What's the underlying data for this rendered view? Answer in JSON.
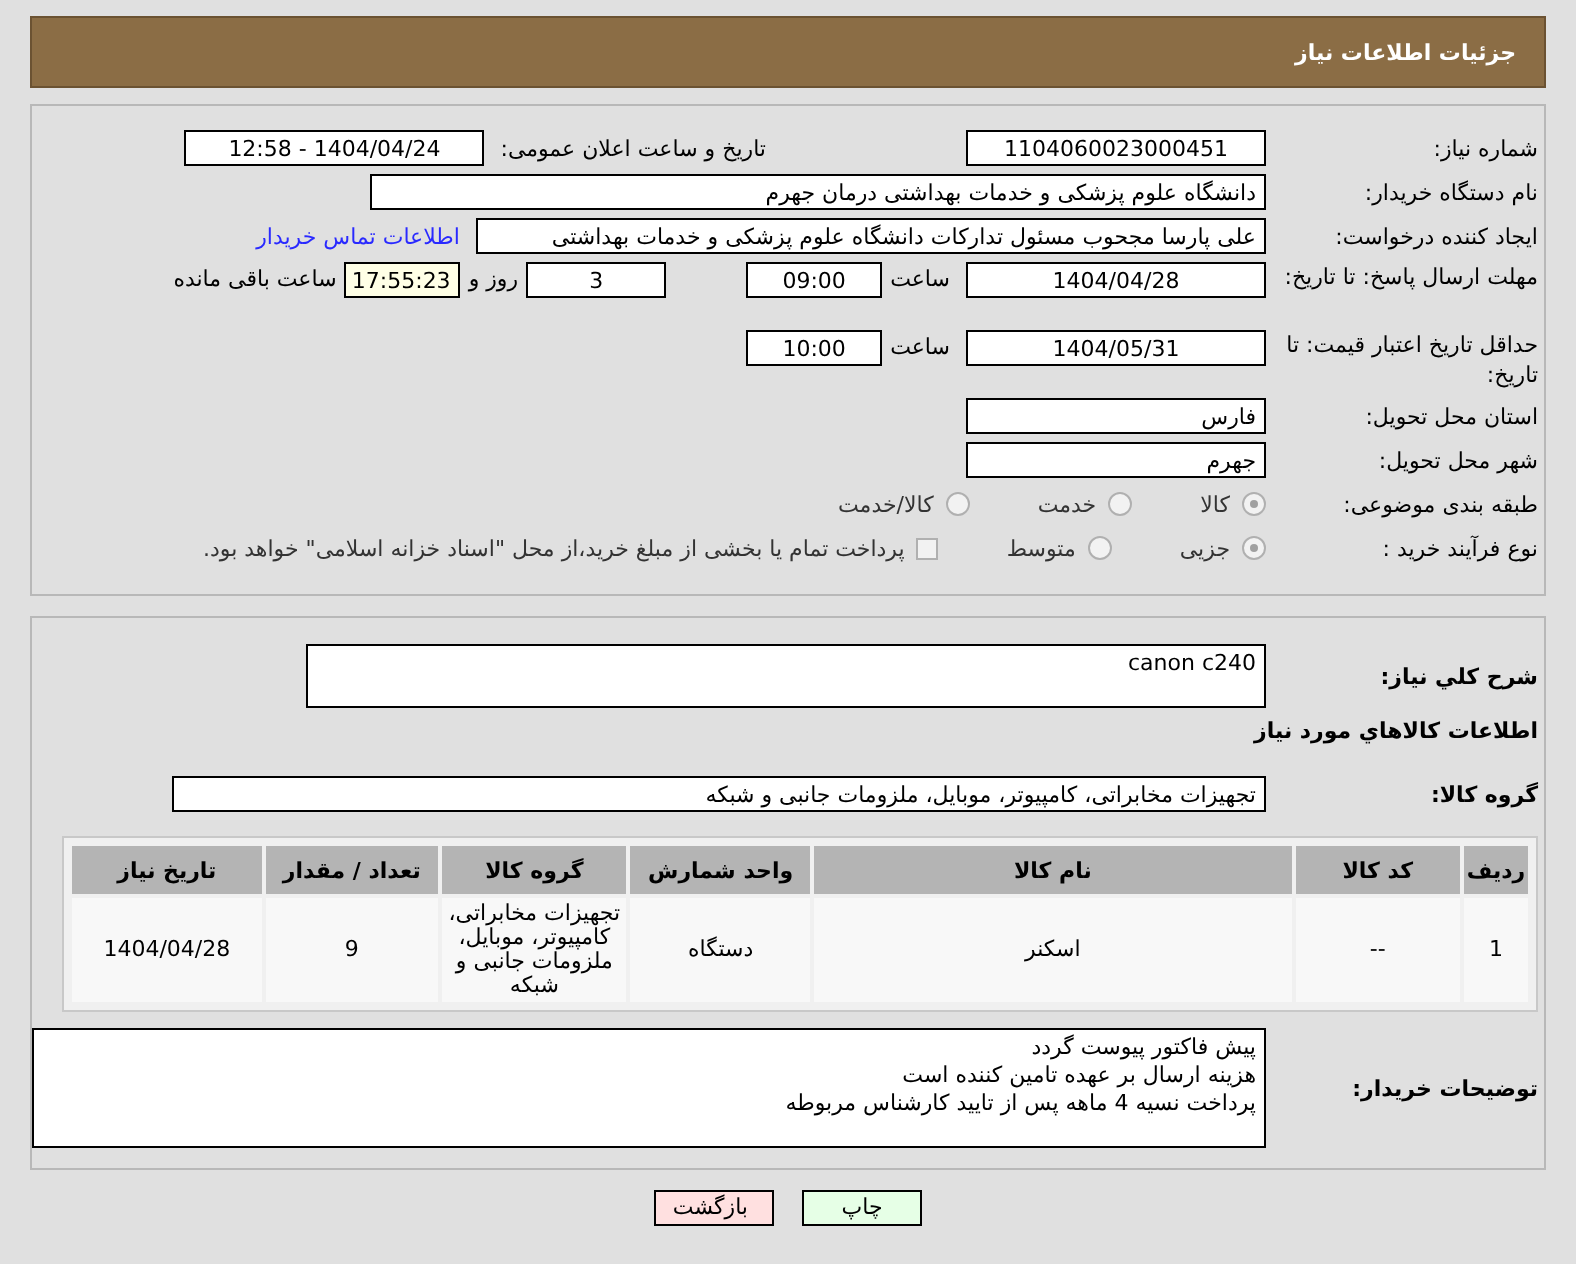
{
  "header": {
    "title": "جزئیات اطلاعات نیاز"
  },
  "need_number": {
    "label": "شماره نیاز:",
    "value": "1104060023000451"
  },
  "announce": {
    "label": "تاریخ و ساعت اعلان عمومی:",
    "value": "1404/04/24 - 12:58"
  },
  "buyer_org": {
    "label": "نام دستگاه خریدار:",
    "value": "دانشگاه علوم پزشکی و خدمات بهداشتی  درمان جهرم"
  },
  "requester": {
    "label": "ایجاد کننده درخواست:",
    "value": "علی پارسا مجحوب مسئول تدارکات دانشگاه علوم پزشکی و خدمات بهداشتی",
    "contact_link": "اطلاعات تماس خریدار"
  },
  "deadline": {
    "label": "مهلت ارسال پاسخ: تا تاریخ:",
    "date": "1404/04/28",
    "time_label": "ساعت",
    "time": "09:00",
    "days": "3",
    "days_label": "روز و",
    "remaining": "17:55:23",
    "remaining_label": "ساعت باقی مانده"
  },
  "price_validity": {
    "label": "حداقل تاریخ اعتبار قیمت: تا تاریخ:",
    "date": "1404/05/31",
    "time_label": "ساعت",
    "time": "10:00"
  },
  "province": {
    "label": "استان محل تحویل:",
    "value": "فارس"
  },
  "city": {
    "label": "شهر محل تحویل:",
    "value": "جهرم"
  },
  "category": {
    "label": "طبقه بندی موضوعی:",
    "options": [
      {
        "label": "کالا",
        "selected": true
      },
      {
        "label": "خدمت",
        "selected": false
      },
      {
        "label": "کالا/خدمت",
        "selected": false
      }
    ]
  },
  "purchase_type": {
    "label": "نوع فرآیند خرید :",
    "options": [
      {
        "label": "جزیی",
        "selected": true
      },
      {
        "label": "متوسط",
        "selected": false
      }
    ],
    "treasury": {
      "label": "پرداخت تمام یا بخشی از مبلغ خرید،از محل \"اسناد خزانه اسلامی\" خواهد بود.",
      "checked": false
    }
  },
  "description": {
    "label": "شرح کلي نیاز:",
    "value": "canon c240"
  },
  "goods_heading": "اطلاعات کالاهاي مورد نیاز",
  "goods_group": {
    "label": "گروه کالا:",
    "value": "تجهیزات مخابراتی، کامپیوتر، موبایل، ملزومات جانبی و شبکه"
  },
  "table": {
    "columns": [
      "ردیف",
      "کد کالا",
      "نام کالا",
      "واحد شمارش",
      "گروه کالا",
      "تعداد / مقدار",
      "تاریخ نیاز"
    ],
    "rows": [
      [
        "1",
        "--",
        "اسکنر",
        "دستگاه",
        "تجهیزات مخابراتی، کامپیوتر، موبایل، ملزومات جانبی و شبکه",
        "9",
        "1404/04/28"
      ]
    ]
  },
  "buyer_notes": {
    "label": "توضیحات خریدار:",
    "lines": [
      "پیش فاکتور پیوست گردد",
      "هزینه ارسال بر عهده تامین کننده است",
      "پرداخت نسیه 4 ماهه پس از تایید کارشناس مربوطه"
    ]
  },
  "buttons": [
    {
      "label": "چاپ",
      "kind": "print"
    },
    {
      "label": "بازگشت",
      "kind": "back"
    }
  ]
}
